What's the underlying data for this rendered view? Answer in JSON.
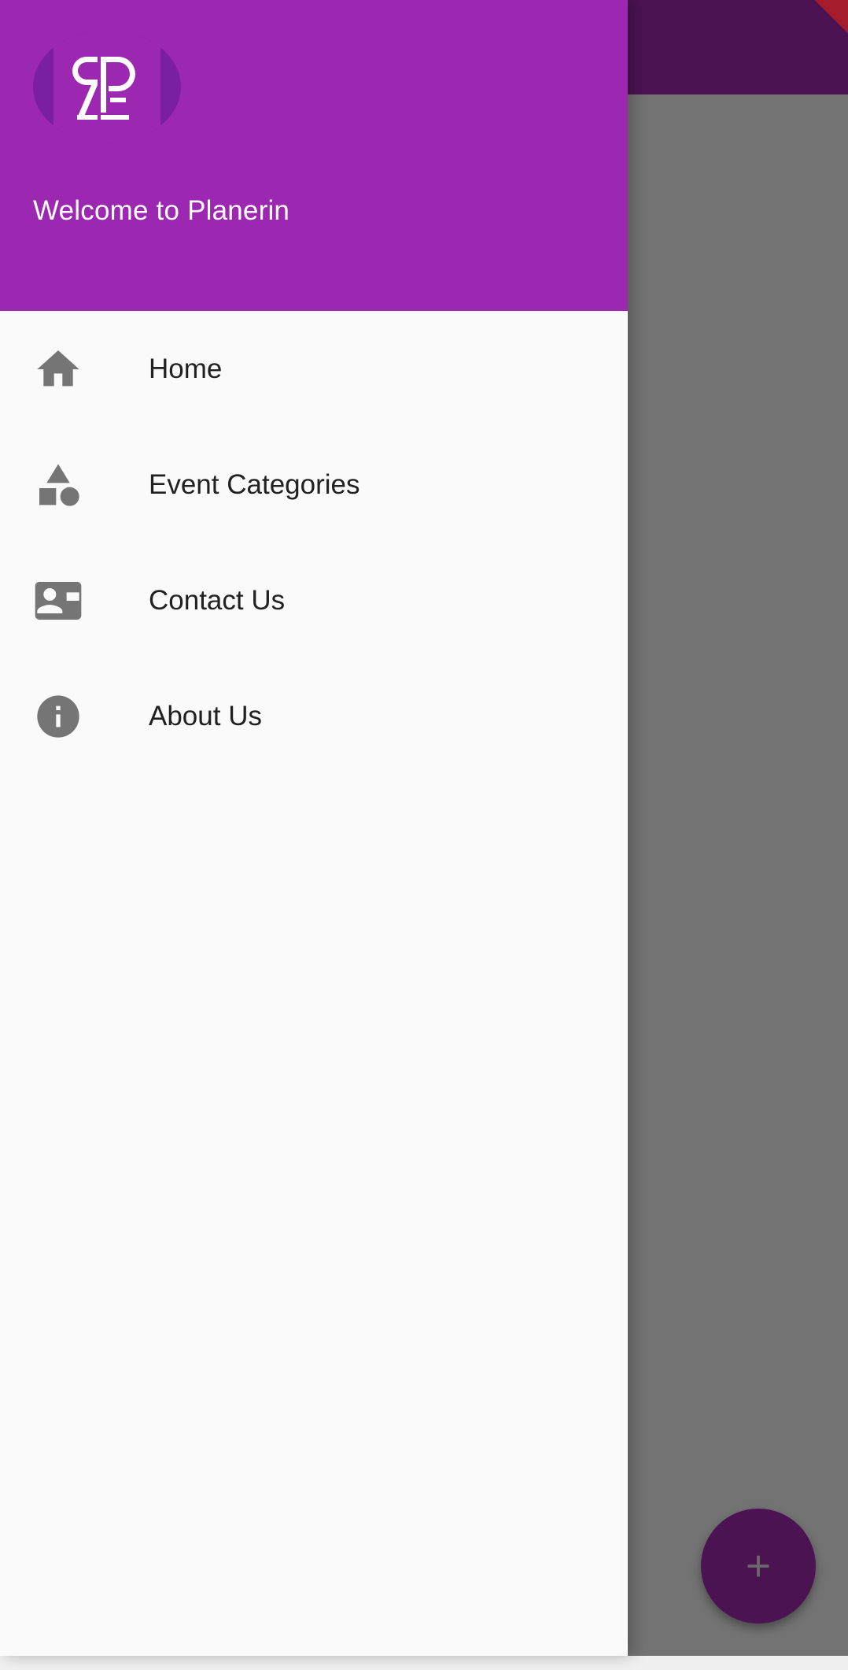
{
  "drawer": {
    "header": {
      "welcome_text": "Welcome to Planerin",
      "logo_icon": "planerin-logo"
    },
    "items": [
      {
        "label": "Home",
        "icon": "home-icon"
      },
      {
        "label": "Event Categories",
        "icon": "category-icon"
      },
      {
        "label": "Contact Us",
        "icon": "contact-mail-icon"
      },
      {
        "label": "About Us",
        "icon": "info-icon"
      }
    ]
  },
  "fab": {
    "icon": "add-icon"
  },
  "colors": {
    "header": "#9c27b0",
    "appbar": "#4b1352",
    "scrim": "#737373",
    "drawer_bg": "#fafafa",
    "icon": "#757575",
    "text": "#212121",
    "debug_ribbon": "#a51d2d"
  }
}
